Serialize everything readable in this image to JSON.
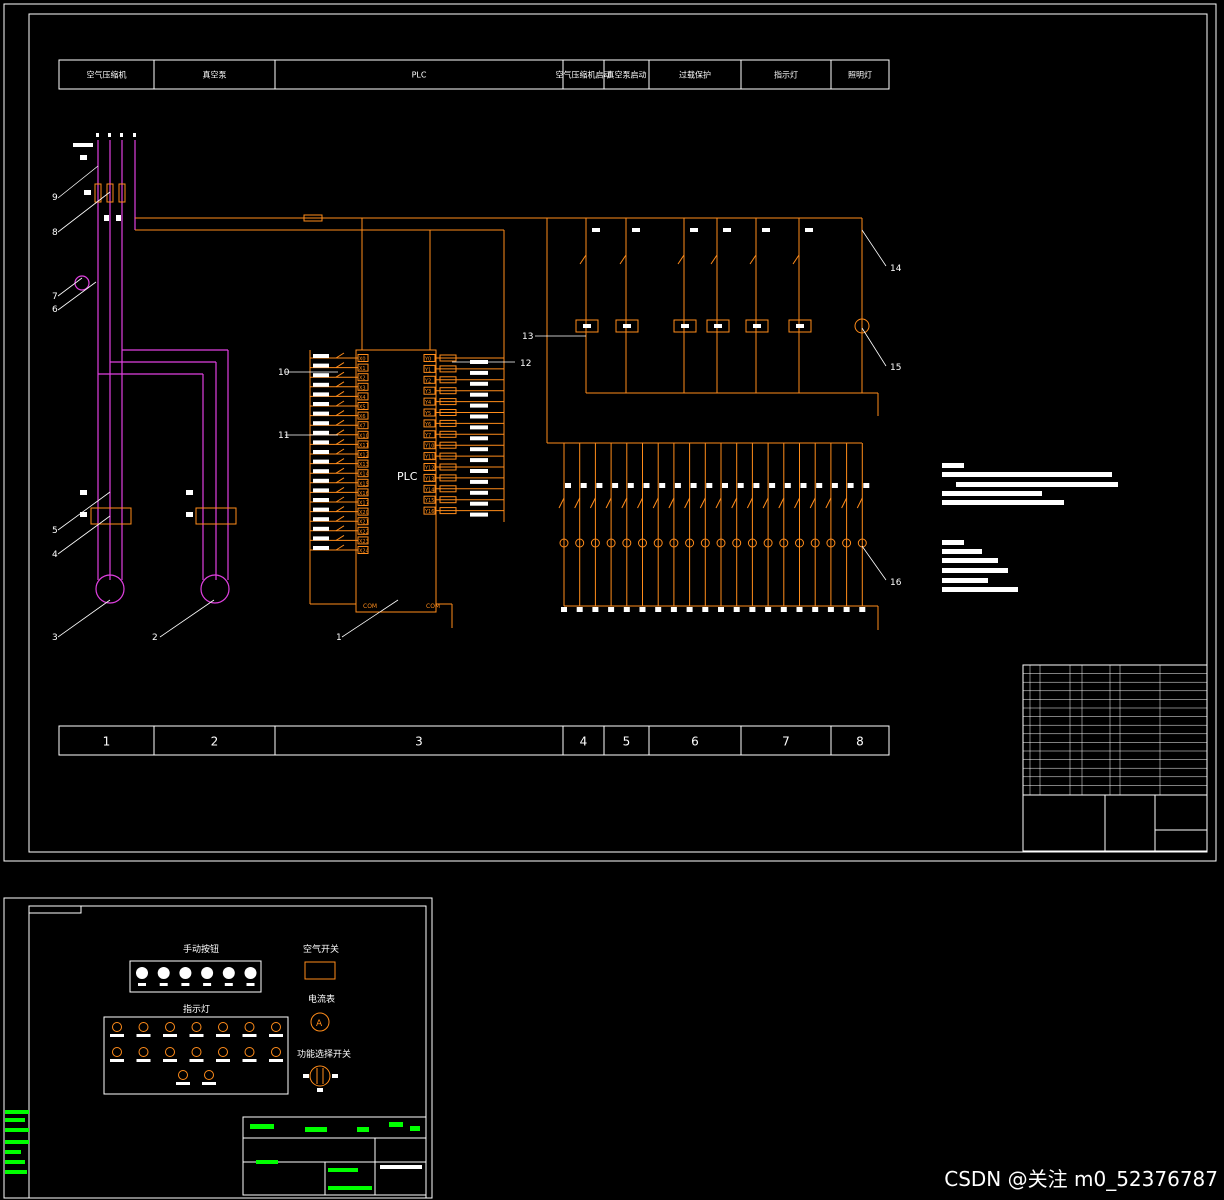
{
  "header_row": [
    "空气压缩机",
    "真空泵",
    "PLC",
    "空气压缩机启动",
    "真空泵启动",
    "过载保护",
    "指示灯",
    "照明灯"
  ],
  "footer_row": [
    "1",
    "2",
    "3",
    "4",
    "5",
    "6",
    "7",
    "8"
  ],
  "plc_label": "PLC",
  "plc_inputs": [
    "X0",
    "X1",
    "X2",
    "X3",
    "X4",
    "X5",
    "X6",
    "X7",
    "X10",
    "X11",
    "X12",
    "X13",
    "X14",
    "X15",
    "X16",
    "X17",
    "X20",
    "X21",
    "X22",
    "X23",
    "X24"
  ],
  "plc_outputs": [
    "Y0",
    "Y1",
    "Y2",
    "Y3",
    "Y4",
    "Y5",
    "Y6",
    "Y7",
    "Y10",
    "Y11",
    "Y12",
    "Y13",
    "Y14",
    "Y15",
    "Y16"
  ],
  "plc_com_left": "COM",
  "plc_com_right": "COM",
  "callouts": [
    "1",
    "2",
    "3",
    "4",
    "5",
    "6",
    "7",
    "8",
    "9",
    "10",
    "11",
    "12",
    "13",
    "14",
    "15",
    "16"
  ],
  "panel_labels": {
    "manual_buttons": "手动按钮",
    "air_switch": "空气开关",
    "indicators": "指示灯",
    "ammeter": "电流表",
    "selector_switch": "功能选择开关",
    "ammeter_symbol": "A"
  },
  "watermark": "CSDN @关注 m0_52376787",
  "colors": {
    "frame": "#ffffff",
    "wire": "#ff8c1a",
    "power": "#e040e0",
    "accent_green": "#00ff00",
    "background": "#000000"
  }
}
